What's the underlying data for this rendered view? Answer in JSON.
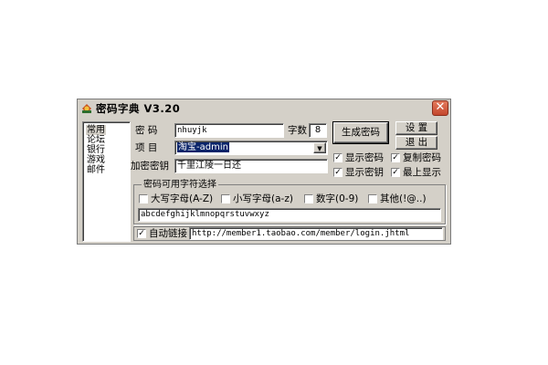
{
  "window": {
    "title": "密码字典 V3.20",
    "close_symbol": "✕",
    "icon": "app-icon"
  },
  "sidebar": {
    "items": [
      "常用",
      "论坛",
      "银行",
      "游戏",
      "邮件"
    ],
    "selected": "常用"
  },
  "form": {
    "password_label": "密   码",
    "password_value": "nhuyjk",
    "length_label": "字数",
    "length_value": "8",
    "item_label": "项   目",
    "item_value": "淘宝-admin",
    "key_label": "加密密钥",
    "key_value": "千里江陵一日还"
  },
  "buttons": {
    "generate": "生成密码",
    "settings": "设 置",
    "exit": "退 出"
  },
  "options": {
    "show_password_1": {
      "label": "显示密码",
      "checked": true
    },
    "copy_password": {
      "label": "复制密码",
      "checked": true
    },
    "show_password_2": {
      "label": "显示密钥",
      "checked": true
    },
    "always_on_top": {
      "label": "最上显示",
      "checked": true
    }
  },
  "charset": {
    "legend": "密码可用字符选择",
    "uppercase": {
      "label": "大写字母(A-Z)",
      "checked": false
    },
    "lowercase": {
      "label": "小写字母(a-z)",
      "checked": false
    },
    "digits": {
      "label": "数字(0-9)",
      "checked": false
    },
    "other": {
      "label": "其他(!@..)",
      "checked": false
    },
    "chars_value": "abcdefghijklmnopqrstuvwxyz"
  },
  "footer": {
    "auto_link_label": "自动链接",
    "auto_link_checked": true,
    "url": "http://member1.taobao.com/member/login.jhtml"
  },
  "colors": {
    "face": "#d4d0c8",
    "selection": "#0a246a",
    "close": "#c4472d"
  }
}
